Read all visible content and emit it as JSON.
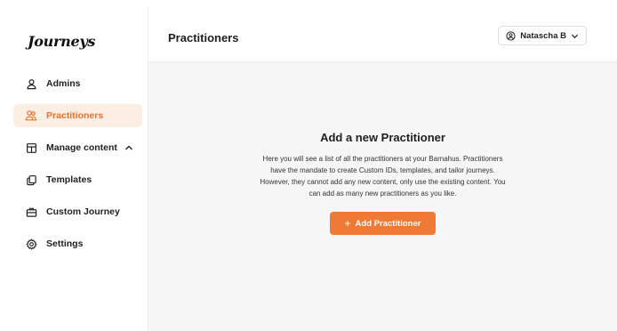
{
  "app": {
    "logo": "Journeys"
  },
  "sidebar": {
    "items": [
      {
        "label": "Admins",
        "icon": "user-icon",
        "active": false
      },
      {
        "label": "Practitioners",
        "icon": "users-icon",
        "active": true
      },
      {
        "label": "Manage content",
        "icon": "content-icon",
        "active": false,
        "expanded": true
      },
      {
        "label": "Templates",
        "icon": "copy-icon",
        "active": false
      },
      {
        "label": "Custom Journey",
        "icon": "briefcase-icon",
        "active": false
      },
      {
        "label": "Settings",
        "icon": "gear-icon",
        "active": false
      }
    ]
  },
  "header": {
    "title": "Practitioners",
    "user_name": "Natascha B"
  },
  "empty_state": {
    "heading": "Add a new Practitioner",
    "description": "Here you will see a list of all the practitioners at your Barnahus. Practitioners have the mandate to create Custom IDs, templates, and tailor journeys. However, they cannot add any new content, only use the existing content. You can add as many new practitioners as you like.",
    "button_label": "Add Practitioner",
    "button_icon": "+"
  },
  "colors": {
    "accent": "#ee7a36",
    "active_bg": "#fdeee3",
    "active_text": "#e8712c",
    "main_bg": "#f6f6f6"
  }
}
